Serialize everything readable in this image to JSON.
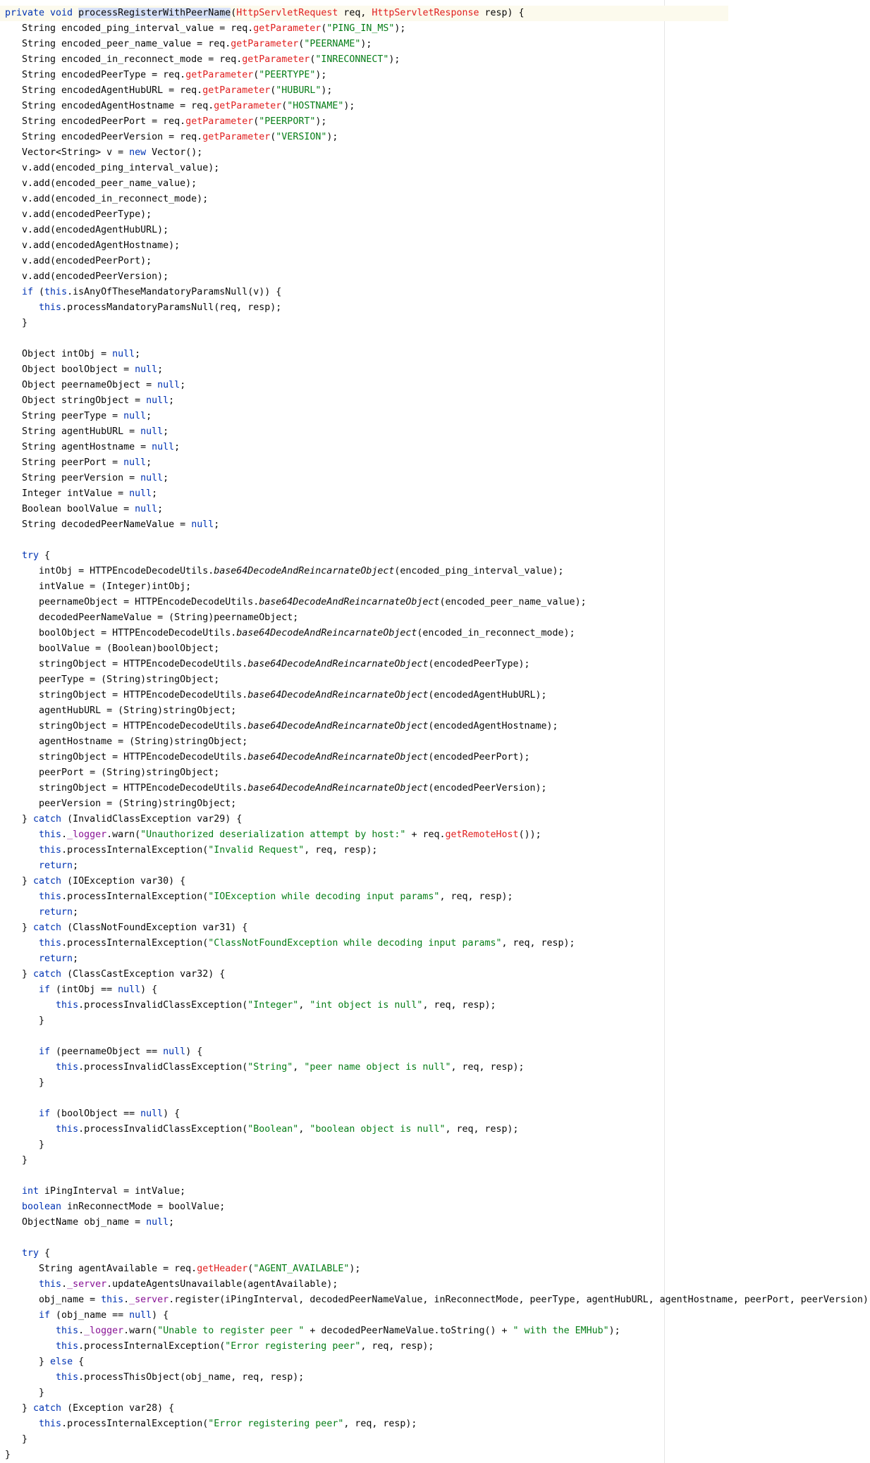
{
  "editor": {
    "language": "java",
    "current_line": 0,
    "highlighted_symbol": "processRegisterWithPeerName",
    "lines": [
      [
        [
          "kw",
          "private void "
        ],
        [
          "hl",
          "processRegisterWithPeerName"
        ],
        [
          "",
          "("
        ],
        [
          "call",
          "HttpServletRequest"
        ],
        [
          "",
          " req, "
        ],
        [
          "call",
          "HttpServletResponse"
        ],
        [
          "",
          " resp) {"
        ]
      ],
      [
        [
          "",
          "   String encoded_ping_interval_value = req."
        ],
        [
          "call",
          "getParameter"
        ],
        [
          "",
          "("
        ],
        [
          "str",
          "\"PING_IN_MS\""
        ],
        [
          "",
          ");"
        ]
      ],
      [
        [
          "",
          "   String encoded_peer_name_value = req."
        ],
        [
          "call",
          "getParameter"
        ],
        [
          "",
          "("
        ],
        [
          "str",
          "\"PEERNAME\""
        ],
        [
          "",
          ");"
        ]
      ],
      [
        [
          "",
          "   String encoded_in_reconnect_mode = req."
        ],
        [
          "call",
          "getParameter"
        ],
        [
          "",
          "("
        ],
        [
          "str",
          "\"INRECONNECT\""
        ],
        [
          "",
          ");"
        ]
      ],
      [
        [
          "",
          "   String encodedPeerType = req."
        ],
        [
          "call",
          "getParameter"
        ],
        [
          "",
          "("
        ],
        [
          "str",
          "\"PEERTYPE\""
        ],
        [
          "",
          ");"
        ]
      ],
      [
        [
          "",
          "   String encodedAgentHubURL = req."
        ],
        [
          "call",
          "getParameter"
        ],
        [
          "",
          "("
        ],
        [
          "str",
          "\"HUBURL\""
        ],
        [
          "",
          ");"
        ]
      ],
      [
        [
          "",
          "   String encodedAgentHostname = req."
        ],
        [
          "call",
          "getParameter"
        ],
        [
          "",
          "("
        ],
        [
          "str",
          "\"HOSTNAME\""
        ],
        [
          "",
          ");"
        ]
      ],
      [
        [
          "",
          "   String encodedPeerPort = req."
        ],
        [
          "call",
          "getParameter"
        ],
        [
          "",
          "("
        ],
        [
          "str",
          "\"PEERPORT\""
        ],
        [
          "",
          ");"
        ]
      ],
      [
        [
          "",
          "   String encodedPeerVersion = req."
        ],
        [
          "call",
          "getParameter"
        ],
        [
          "",
          "("
        ],
        [
          "str",
          "\"VERSION\""
        ],
        [
          "",
          ");"
        ]
      ],
      [
        [
          "",
          "   Vector<String> v = "
        ],
        [
          "kw",
          "new"
        ],
        [
          "",
          " Vector();"
        ]
      ],
      [
        [
          "",
          "   v.add(encoded_ping_interval_value);"
        ]
      ],
      [
        [
          "",
          "   v.add(encoded_peer_name_value);"
        ]
      ],
      [
        [
          "",
          "   v.add(encoded_in_reconnect_mode);"
        ]
      ],
      [
        [
          "",
          "   v.add(encodedPeerType);"
        ]
      ],
      [
        [
          "",
          "   v.add(encodedAgentHubURL);"
        ]
      ],
      [
        [
          "",
          "   v.add(encodedAgentHostname);"
        ]
      ],
      [
        [
          "",
          "   v.add(encodedPeerPort);"
        ]
      ],
      [
        [
          "",
          "   v.add(encodedPeerVersion);"
        ]
      ],
      [
        [
          "kw",
          "   if"
        ],
        [
          "",
          " ("
        ],
        [
          "kw",
          "this"
        ],
        [
          "",
          ".isAnyOfTheseMandatoryParamsNull(v)) {"
        ]
      ],
      [
        [
          "kw",
          "      this"
        ],
        [
          "",
          ".processMandatoryParamsNull(req, resp);"
        ]
      ],
      [
        [
          "",
          "   }"
        ]
      ],
      [
        [
          "",
          ""
        ]
      ],
      [
        [
          "",
          "   Object intObj = "
        ],
        [
          "kw",
          "null"
        ],
        [
          "",
          ";"
        ]
      ],
      [
        [
          "",
          "   Object boolObject = "
        ],
        [
          "kw",
          "null"
        ],
        [
          "",
          ";"
        ]
      ],
      [
        [
          "",
          "   Object peernameObject = "
        ],
        [
          "kw",
          "null"
        ],
        [
          "",
          ";"
        ]
      ],
      [
        [
          "",
          "   Object stringObject = "
        ],
        [
          "kw",
          "null"
        ],
        [
          "",
          ";"
        ]
      ],
      [
        [
          "",
          "   String peerType = "
        ],
        [
          "kw",
          "null"
        ],
        [
          "",
          ";"
        ]
      ],
      [
        [
          "",
          "   String agentHubURL = "
        ],
        [
          "kw",
          "null"
        ],
        [
          "",
          ";"
        ]
      ],
      [
        [
          "",
          "   String agentHostname = "
        ],
        [
          "kw",
          "null"
        ],
        [
          "",
          ";"
        ]
      ],
      [
        [
          "",
          "   String peerPort = "
        ],
        [
          "kw",
          "null"
        ],
        [
          "",
          ";"
        ]
      ],
      [
        [
          "",
          "   String peerVersion = "
        ],
        [
          "kw",
          "null"
        ],
        [
          "",
          ";"
        ]
      ],
      [
        [
          "",
          "   Integer intValue = "
        ],
        [
          "kw",
          "null"
        ],
        [
          "",
          ";"
        ]
      ],
      [
        [
          "",
          "   Boolean boolValue = "
        ],
        [
          "kw",
          "null"
        ],
        [
          "",
          ";"
        ]
      ],
      [
        [
          "",
          "   String decodedPeerNameValue = "
        ],
        [
          "kw",
          "null"
        ],
        [
          "",
          ";"
        ]
      ],
      [
        [
          "",
          ""
        ]
      ],
      [
        [
          "kw",
          "   try"
        ],
        [
          "",
          " {"
        ]
      ],
      [
        [
          "",
          "      intObj = HTTPEncodeDecodeUtils."
        ],
        [
          "ital",
          "base64DecodeAndReincarnateObject"
        ],
        [
          "",
          "(encoded_ping_interval_value);"
        ]
      ],
      [
        [
          "",
          "      intValue = (Integer)intObj;"
        ]
      ],
      [
        [
          "",
          "      peernameObject = HTTPEncodeDecodeUtils."
        ],
        [
          "ital",
          "base64DecodeAndReincarnateObject"
        ],
        [
          "",
          "(encoded_peer_name_value);"
        ]
      ],
      [
        [
          "",
          "      decodedPeerNameValue = (String)peernameObject;"
        ]
      ],
      [
        [
          "",
          "      boolObject = HTTPEncodeDecodeUtils."
        ],
        [
          "ital",
          "base64DecodeAndReincarnateObject"
        ],
        [
          "",
          "(encoded_in_reconnect_mode);"
        ]
      ],
      [
        [
          "",
          "      boolValue = (Boolean)boolObject;"
        ]
      ],
      [
        [
          "",
          "      stringObject = HTTPEncodeDecodeUtils."
        ],
        [
          "ital",
          "base64DecodeAndReincarnateObject"
        ],
        [
          "",
          "(encodedPeerType);"
        ]
      ],
      [
        [
          "",
          "      peerType = (String)stringObject;"
        ]
      ],
      [
        [
          "",
          "      stringObject = HTTPEncodeDecodeUtils."
        ],
        [
          "ital",
          "base64DecodeAndReincarnateObject"
        ],
        [
          "",
          "(encodedAgentHubURL);"
        ]
      ],
      [
        [
          "",
          "      agentHubURL = (String)stringObject;"
        ]
      ],
      [
        [
          "",
          "      stringObject = HTTPEncodeDecodeUtils."
        ],
        [
          "ital",
          "base64DecodeAndReincarnateObject"
        ],
        [
          "",
          "(encodedAgentHostname);"
        ]
      ],
      [
        [
          "",
          "      agentHostname = (String)stringObject;"
        ]
      ],
      [
        [
          "",
          "      stringObject = HTTPEncodeDecodeUtils."
        ],
        [
          "ital",
          "base64DecodeAndReincarnateObject"
        ],
        [
          "",
          "(encodedPeerPort);"
        ]
      ],
      [
        [
          "",
          "      peerPort = (String)stringObject;"
        ]
      ],
      [
        [
          "",
          "      stringObject = HTTPEncodeDecodeUtils."
        ],
        [
          "ital",
          "base64DecodeAndReincarnateObject"
        ],
        [
          "",
          "(encodedPeerVersion);"
        ]
      ],
      [
        [
          "",
          "      peerVersion = (String)stringObject;"
        ]
      ],
      [
        [
          "",
          "   } "
        ],
        [
          "kw",
          "catch"
        ],
        [
          "",
          " (InvalidClassException var29) {"
        ]
      ],
      [
        [
          "kw",
          "      this"
        ],
        [
          "",
          "."
        ],
        [
          "fld",
          "_logger"
        ],
        [
          "",
          ".warn("
        ],
        [
          "str",
          "\"Unauthorized deserialization attempt by host:\""
        ],
        [
          "",
          " + req."
        ],
        [
          "call",
          "getRemoteHost"
        ],
        [
          "",
          "());"
        ]
      ],
      [
        [
          "kw",
          "      this"
        ],
        [
          "",
          ".processInternalException("
        ],
        [
          "str",
          "\"Invalid Request\""
        ],
        [
          "",
          ", req, resp);"
        ]
      ],
      [
        [
          "kw",
          "      return"
        ],
        [
          "",
          ";"
        ]
      ],
      [
        [
          "",
          "   } "
        ],
        [
          "kw",
          "catch"
        ],
        [
          "",
          " (IOException var30) {"
        ]
      ],
      [
        [
          "kw",
          "      this"
        ],
        [
          "",
          ".processInternalException("
        ],
        [
          "str",
          "\"IOException while decoding input params\""
        ],
        [
          "",
          ", req, resp);"
        ]
      ],
      [
        [
          "kw",
          "      return"
        ],
        [
          "",
          ";"
        ]
      ],
      [
        [
          "",
          "   } "
        ],
        [
          "kw",
          "catch"
        ],
        [
          "",
          " (ClassNotFoundException var31) {"
        ]
      ],
      [
        [
          "kw",
          "      this"
        ],
        [
          "",
          ".processInternalException("
        ],
        [
          "str",
          "\"ClassNotFoundException while decoding input params\""
        ],
        [
          "",
          ", req, resp);"
        ]
      ],
      [
        [
          "kw",
          "      return"
        ],
        [
          "",
          ";"
        ]
      ],
      [
        [
          "",
          "   } "
        ],
        [
          "kw",
          "catch"
        ],
        [
          "",
          " (ClassCastException var32) {"
        ]
      ],
      [
        [
          "kw",
          "      if"
        ],
        [
          "",
          " (intObj == "
        ],
        [
          "kw",
          "null"
        ],
        [
          "",
          ") {"
        ]
      ],
      [
        [
          "kw",
          "         this"
        ],
        [
          "",
          ".processInvalidClassException("
        ],
        [
          "str",
          "\"Integer\""
        ],
        [
          "",
          ", "
        ],
        [
          "str",
          "\"int object is null\""
        ],
        [
          "",
          ", req, resp);"
        ]
      ],
      [
        [
          "",
          "      }"
        ]
      ],
      [
        [
          "",
          ""
        ]
      ],
      [
        [
          "kw",
          "      if"
        ],
        [
          "",
          " (peernameObject == "
        ],
        [
          "kw",
          "null"
        ],
        [
          "",
          ") {"
        ]
      ],
      [
        [
          "kw",
          "         this"
        ],
        [
          "",
          ".processInvalidClassException("
        ],
        [
          "str",
          "\"String\""
        ],
        [
          "",
          ", "
        ],
        [
          "str",
          "\"peer name object is null\""
        ],
        [
          "",
          ", req, resp);"
        ]
      ],
      [
        [
          "",
          "      }"
        ]
      ],
      [
        [
          "",
          ""
        ]
      ],
      [
        [
          "kw",
          "      if"
        ],
        [
          "",
          " (boolObject == "
        ],
        [
          "kw",
          "null"
        ],
        [
          "",
          ") {"
        ]
      ],
      [
        [
          "kw",
          "         this"
        ],
        [
          "",
          ".processInvalidClassException("
        ],
        [
          "str",
          "\"Boolean\""
        ],
        [
          "",
          ", "
        ],
        [
          "str",
          "\"boolean object is null\""
        ],
        [
          "",
          ", req, resp);"
        ]
      ],
      [
        [
          "",
          "      }"
        ]
      ],
      [
        [
          "",
          "   }"
        ]
      ],
      [
        [
          "",
          ""
        ]
      ],
      [
        [
          "kw",
          "   int"
        ],
        [
          "",
          " iPingInterval = intValue;"
        ]
      ],
      [
        [
          "kw",
          "   boolean"
        ],
        [
          "",
          " inReconnectMode = boolValue;"
        ]
      ],
      [
        [
          "",
          "   ObjectName obj_name = "
        ],
        [
          "kw",
          "null"
        ],
        [
          "",
          ";"
        ]
      ],
      [
        [
          "",
          ""
        ]
      ],
      [
        [
          "kw",
          "   try"
        ],
        [
          "",
          " {"
        ]
      ],
      [
        [
          "",
          "      String agentAvailable = req."
        ],
        [
          "call",
          "getHeader"
        ],
        [
          "",
          "("
        ],
        [
          "str",
          "\"AGENT_AVAILABLE\""
        ],
        [
          "",
          ");"
        ]
      ],
      [
        [
          "kw",
          "      this"
        ],
        [
          "",
          "."
        ],
        [
          "fld",
          "_server"
        ],
        [
          "",
          ".updateAgentsUnavailable(agentAvailable);"
        ]
      ],
      [
        [
          "",
          "      obj_name = "
        ],
        [
          "kw",
          "this"
        ],
        [
          "",
          "."
        ],
        [
          "fld",
          "_server"
        ],
        [
          "",
          ".register(iPingInterval, decodedPeerNameValue, inReconnectMode, peerType, agentHubURL, agentHostname, peerPort, peerVersion);"
        ]
      ],
      [
        [
          "kw",
          "      if"
        ],
        [
          "",
          " (obj_name == "
        ],
        [
          "kw",
          "null"
        ],
        [
          "",
          ") {"
        ]
      ],
      [
        [
          "kw",
          "         this"
        ],
        [
          "",
          "."
        ],
        [
          "fld",
          "_logger"
        ],
        [
          "",
          ".warn("
        ],
        [
          "str",
          "\"Unable to register peer \""
        ],
        [
          "",
          " + decodedPeerNameValue.toString() + "
        ],
        [
          "str",
          "\" with the EMHub\""
        ],
        [
          "",
          ");"
        ]
      ],
      [
        [
          "kw",
          "         this"
        ],
        [
          "",
          ".processInternalException("
        ],
        [
          "str",
          "\"Error registering peer\""
        ],
        [
          "",
          ", req, resp);"
        ]
      ],
      [
        [
          "",
          "      } "
        ],
        [
          "kw",
          "else"
        ],
        [
          "",
          " {"
        ]
      ],
      [
        [
          "kw",
          "         this"
        ],
        [
          "",
          ".processThisObject(obj_name, req, resp);"
        ]
      ],
      [
        [
          "",
          "      }"
        ]
      ],
      [
        [
          "",
          "   } "
        ],
        [
          "kw",
          "catch"
        ],
        [
          "",
          " (Exception var28) {"
        ]
      ],
      [
        [
          "kw",
          "      this"
        ],
        [
          "",
          ".processInternalException("
        ],
        [
          "str",
          "\"Error registering peer\""
        ],
        [
          "",
          ", req, resp);"
        ]
      ],
      [
        [
          "",
          "   }"
        ]
      ],
      [
        [
          "",
          "}"
        ]
      ]
    ]
  },
  "colors": {
    "keyword": "#0033b3",
    "string": "#067d17",
    "method_call": "#e01e1e",
    "field": "#871094",
    "text": "#080808",
    "current_line_bg": "#fcfaed",
    "selection_bg": "#d7e1f8"
  }
}
